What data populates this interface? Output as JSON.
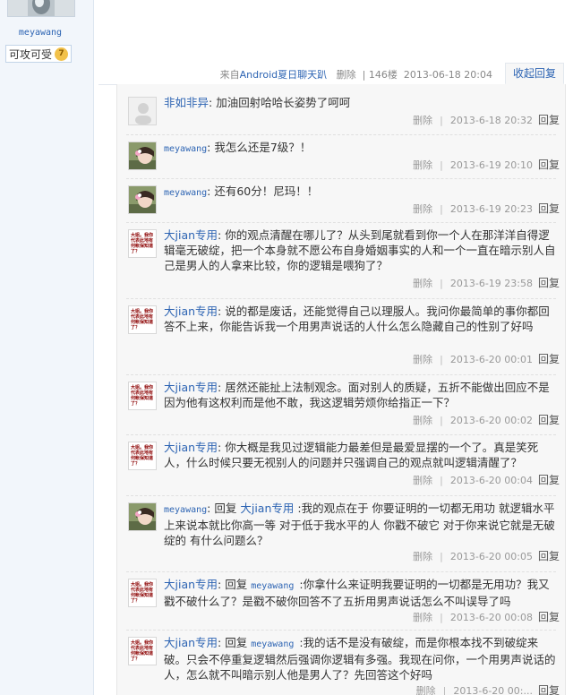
{
  "sidebar": {
    "username": "meyawang",
    "badge_label": "可攻可受",
    "badge_level": "7"
  },
  "post_meta": {
    "prefix": "来自",
    "app": "Android",
    "app_name": "夏日聊天趴",
    "delete": "删除",
    "floor": "146楼",
    "date": "2013-06-18 20:04",
    "collapse": "收起回复"
  },
  "replies": [
    {
      "name": "非如非异",
      "mono": false,
      "avatar": "default",
      "text": "加油回射哈哈长姿势了呵呵",
      "time": "2013-6-18 20:32"
    },
    {
      "name": "meyawang",
      "mono": true,
      "avatar": "photo",
      "text": "我怎么还是7级？！",
      "time": "2013-6-19 20:10"
    },
    {
      "name": "meyawang",
      "mono": true,
      "avatar": "photo",
      "text": "还有60分！尼玛！！",
      "time": "2013-6-19 20:23"
    },
    {
      "name": "大jian专用",
      "mono": false,
      "avatar": "text",
      "text": "你的观点清醒在哪儿了？从头到尾就看到你一个人在那洋洋自得逻辑毫无破绽，把一个本身就不愿公布自身婚姻事实的人和一个一直在暗示别人自己是男人的人拿来比较，你的逻辑是喂狗了？",
      "time": "2013-6-19 23:58"
    },
    {
      "name": "大jian专用",
      "mono": false,
      "avatar": "text",
      "text": "说的都是废话，还能觉得自己以理服人。我问你最简单的事你都回答不上来，你能告诉我一个用男声说话的人什么怎么隐藏自己的性别了好吗",
      "time": "2013-6-20 00:01"
    },
    {
      "name": "大jian专用",
      "mono": false,
      "avatar": "text",
      "text": "居然还能扯上法制观念。面对别人的质疑，五折不能做出回应不是因为他有这权利而是他不敢，我这逻辑劳烦你给指正一下？",
      "time": "2013-6-20 00:02"
    },
    {
      "name": "大jian专用",
      "mono": false,
      "avatar": "text",
      "text": "你大概是我见过逻辑能力最差但是最爱显摆的一个了。真是笑死人，什么时候只要无视别人的问题并只强调自己的观点就叫逻辑清醒了？",
      "time": "2013-6-20 00:04"
    },
    {
      "name": "meyawang",
      "mono": true,
      "avatar": "photo",
      "reply_prefix": "回复",
      "reply_to": "大jian专用",
      "text": ":我的观点在于 你要证明的一切都无用功 就逻辑水平上来说本就比你高一等 对于低于我水平的人 你戳不破它 对于你来说它就是无破绽的 有什么问题么？",
      "time": "2013-6-20 00:05"
    },
    {
      "name": "大jian专用",
      "mono": false,
      "avatar": "text",
      "reply_prefix": "回复",
      "reply_to": "meyawang",
      "text": ":你拿什么来证明我要证明的一切都是无用功？我又戳不破什么了？是戳不破你回答不了五折用男声说话怎么不叫误导了吗",
      "time": "2013-6-20 00:08"
    },
    {
      "name": "大jian专用",
      "mono": false,
      "avatar": "text",
      "reply_prefix": "回复",
      "reply_to": "meyawang",
      "text": ":我的话不是没有破绽，而是你根本找不到破绽来破。只会不停重复逻辑然后强调你逻辑有多强。我现在问你，一个用男声说话的人，怎么就不叫暗示别人他是男人了？先回答这个好吗",
      "time": "2013-6-20 00:..."
    }
  ],
  "labels": {
    "delete": "删除",
    "reply": "回复"
  },
  "avatar_text": "大姐。我你代表此地有何帐保知道了？"
}
